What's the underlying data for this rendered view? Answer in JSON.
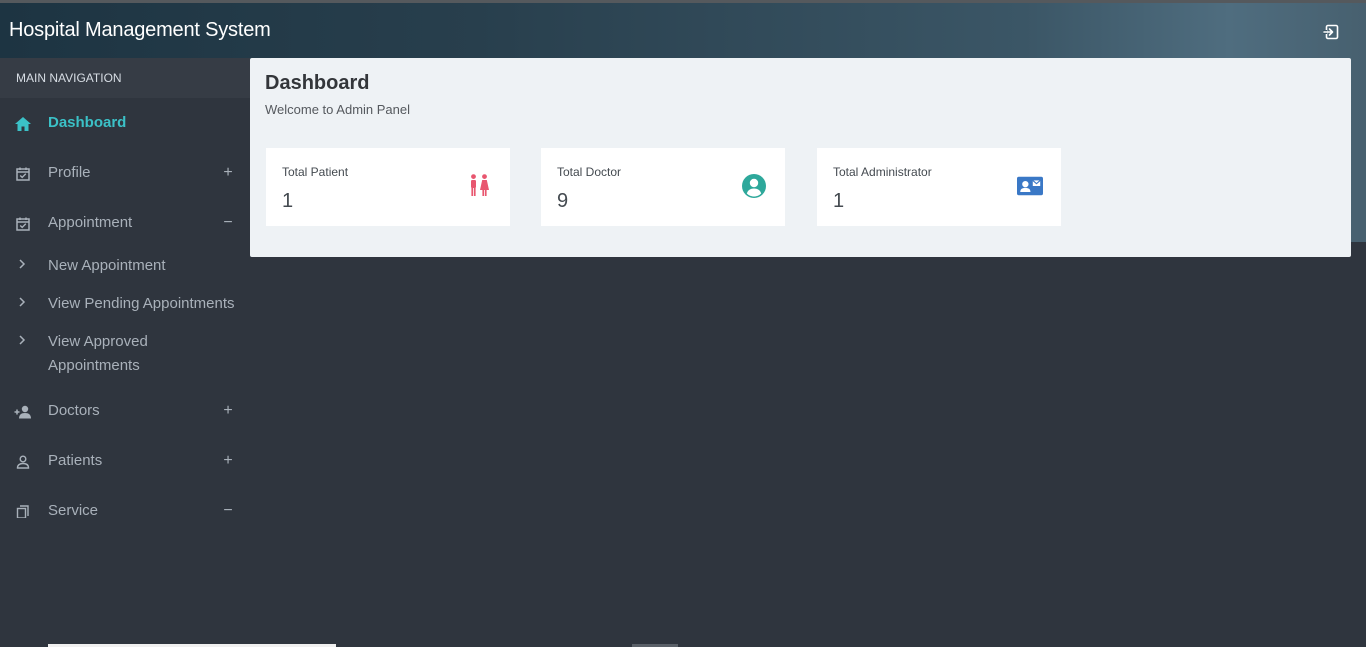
{
  "app": {
    "title": "Hospital Management System"
  },
  "sidebar": {
    "header": "MAIN NAVIGATION",
    "items": [
      {
        "label": "Dashboard",
        "icon": "home-icon",
        "toggle": "",
        "active": true
      },
      {
        "label": "Profile",
        "icon": "calendar-check-icon",
        "toggle": "+"
      },
      {
        "label": "Appointment",
        "icon": "calendar-check-icon",
        "toggle": "−"
      },
      {
        "label": "Doctors",
        "icon": "user-plus-icon",
        "toggle": "+"
      },
      {
        "label": "Patients",
        "icon": "user-icon",
        "toggle": "+"
      },
      {
        "label": "Service",
        "icon": "copy-icon",
        "toggle": "−"
      }
    ],
    "appointment_sub": [
      {
        "label": "New Appointment"
      },
      {
        "label": "View Pending Appointments"
      },
      {
        "label": "View Approved Appointments"
      }
    ]
  },
  "dashboard": {
    "title": "Dashboard",
    "subtitle": "Welcome to Admin Panel",
    "cards": [
      {
        "label": "Total Patient",
        "value": "1",
        "icon": "restroom-icon",
        "icon_color": "#e8566f"
      },
      {
        "label": "Total Doctor",
        "value": "9",
        "icon": "user-circle-icon",
        "icon_color": "#2ea89b"
      },
      {
        "label": "Total Administrator",
        "value": "1",
        "icon": "contact-card-icon",
        "icon_color": "#3a78c6"
      }
    ]
  },
  "colors": {
    "accent": "#3bc1c7",
    "sidebar_bg": "#2f353e",
    "panel_bg": "#eef2f5"
  }
}
